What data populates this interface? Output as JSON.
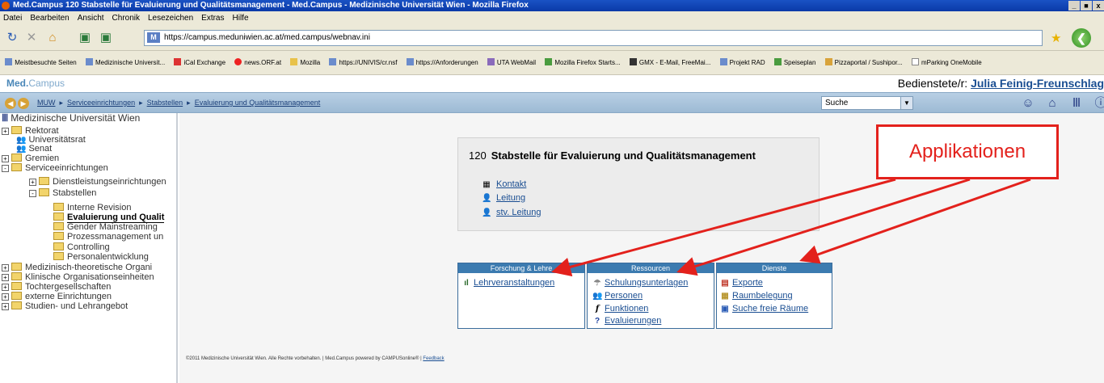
{
  "window": {
    "title": "Med.Campus 120 Stabstelle für Evaluierung und Qualitätsmanagement - Med.Campus - Medizinische Universität Wien - Mozilla Firefox",
    "controls": [
      "_",
      "■",
      "x"
    ]
  },
  "menu": [
    "Datei",
    "Bearbeiten",
    "Ansicht",
    "Chronik",
    "Lesezeichen",
    "Extras",
    "Hilfe"
  ],
  "url": "https://campus.meduniwien.ac.at/med.campus/webnav.ini",
  "bookmarks": [
    "Meistbesuchte Seiten",
    "Medizinische Universit...",
    "iCal Exchange",
    "news.ORF.at",
    "Mozilla",
    "https://UNIVIS/cr.nsf",
    "https://Anforderungen",
    "UTA WebMail",
    "Mozilla Firefox Starts...",
    "GMX - E-Mail, FreeMai...",
    "Projekt RAD",
    "Speiseplan",
    "Pizzaportal / Sushipor...",
    "mParking OneMobile"
  ],
  "header": {
    "logo_bold": "Med.",
    "logo_light": "Campus",
    "user_prefix": "Bedienstete/r:",
    "user_name": "Julia Feinig-Freunschlag"
  },
  "breadcrumb": [
    "MUW",
    "Serviceeinrichtungen",
    "Stabstellen",
    "Evaluierung und Qualitätsmanagement"
  ],
  "search": {
    "value": "Suche"
  },
  "sidebar": {
    "root": "Medizinische Universität Wien",
    "items": [
      {
        "label": "Rektorat",
        "type": "folder",
        "toggle": "+"
      },
      {
        "label": "Universitätsrat",
        "type": "people"
      },
      {
        "label": "Senat",
        "type": "people"
      },
      {
        "label": "Gremien",
        "type": "folder",
        "toggle": "+"
      },
      {
        "label": "Serviceeinrichtungen",
        "type": "folder",
        "toggle": "-"
      },
      {
        "label": "Dienstleistungseinrichtungen",
        "type": "folder",
        "toggle": "+"
      },
      {
        "label": "Stabstellen",
        "type": "folder",
        "toggle": "-"
      },
      {
        "label": "Interne Revision",
        "type": "folder"
      },
      {
        "label": "Evaluierung und Qualit",
        "type": "folder",
        "active": true
      },
      {
        "label": "Gender Mainstreaming",
        "type": "folder"
      },
      {
        "label": "Prozessmanagement un",
        "type": "folder"
      },
      {
        "label": "Controlling",
        "type": "folder"
      },
      {
        "label": "Personalentwicklung",
        "type": "folder"
      },
      {
        "label": "Medizinisch-theoretische Organi",
        "type": "folder",
        "toggle": "+"
      },
      {
        "label": "Klinische Organisationseinheiten",
        "type": "folder",
        "toggle": "+"
      },
      {
        "label": "Tochtergesellschaften",
        "type": "folder",
        "toggle": "+"
      },
      {
        "label": "externe Einrichtungen",
        "type": "folder",
        "toggle": "+"
      },
      {
        "label": "Studien- und Lehrangebot",
        "type": "folder",
        "toggle": "+"
      }
    ]
  },
  "org": {
    "number": "120",
    "name": "Stabstelle für Evaluierung und Qualitätsmanagement",
    "links": [
      "Kontakt",
      "Leitung",
      "stv. Leitung"
    ]
  },
  "panels": [
    {
      "title": "Forschung & Lehre",
      "items": [
        "Lehrveranstaltungen"
      ]
    },
    {
      "title": "Ressourcen",
      "items": [
        "Schulungsunterlagen",
        "Personen",
        "Funktionen",
        "Evaluierungen"
      ]
    },
    {
      "title": "Dienste",
      "items": [
        "Exporte",
        "Raumbelegung",
        "Suche freie Räume"
      ]
    }
  ],
  "footer": {
    "text": "©2011 Medizinische Universität Wien. Alle Rechte vorbehalten. | Med.Campus powered by CAMPUSonline® |",
    "link": "Feedback"
  },
  "annotation": {
    "label": "Applikationen",
    "color": "#e3211c"
  }
}
